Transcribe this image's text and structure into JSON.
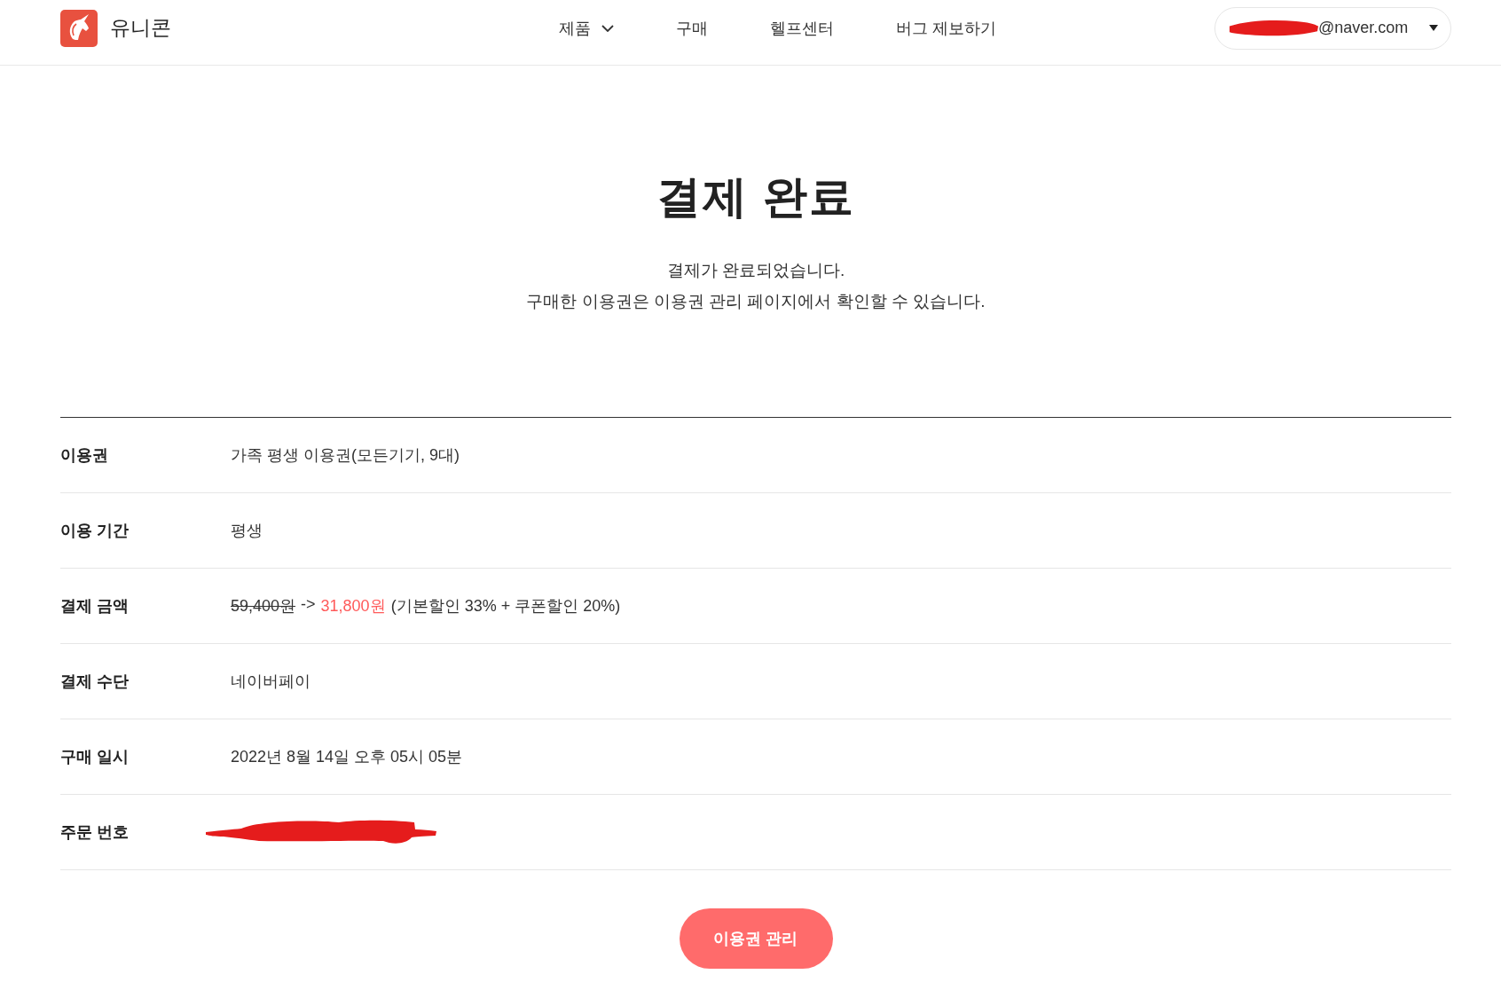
{
  "header": {
    "logo": {
      "name": "유니콘"
    },
    "nav": [
      {
        "label": "제품",
        "dropdown": true
      },
      {
        "label": "구매",
        "dropdown": false
      },
      {
        "label": "헬프센터",
        "dropdown": false
      },
      {
        "label": "버그 제보하기",
        "dropdown": false
      }
    ],
    "account": {
      "email": "@naver.com",
      "redacted": true
    }
  },
  "title": "결제 완료",
  "message": [
    "결제가 완료되었습니다.",
    "구매한 이용권은 이용권 관리 페이지에서 확인할 수 있습니다."
  ],
  "details": [
    {
      "kind": "text",
      "label": "이용권",
      "value": "가족 평생 이용권(모든기기, 9대)"
    },
    {
      "kind": "text",
      "label": "이용 기간",
      "value": "평생"
    },
    {
      "kind": "price",
      "label": "결제 금액",
      "original": "59,400원",
      "arrow": "->",
      "final": "31,800원",
      "note": "(기본할인 33% + 쿠폰할인 20%)"
    },
    {
      "kind": "text",
      "label": "결제 수단",
      "value": "네이버페이"
    },
    {
      "kind": "text",
      "label": "구매 일시",
      "value": "2022년 8월 14일 오후 05시 05분"
    },
    {
      "kind": "redacted",
      "label": "주문 번호"
    }
  ],
  "button": {
    "label": "이용권 관리"
  }
}
